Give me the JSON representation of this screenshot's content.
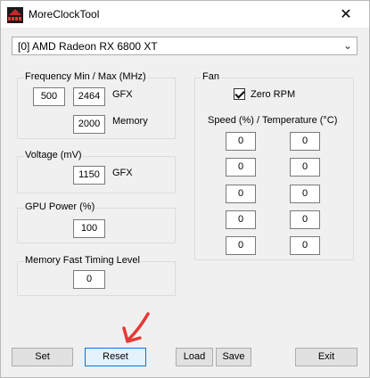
{
  "window": {
    "title": "MoreClockTool",
    "close_glyph": "✕",
    "icon": "app-logo-icon"
  },
  "gpu_select": {
    "value": "[0] AMD Radeon RX 6800 XT",
    "arrow": "⌄"
  },
  "frequency": {
    "title": "Frequency Min / Max (MHz)",
    "min": "500",
    "max": "2464",
    "gfx_label": "GFX",
    "memory": "2000",
    "memory_label": "Memory"
  },
  "voltage": {
    "title": "Voltage (mV)",
    "value": "1150",
    "gfx_label": "GFX"
  },
  "power": {
    "title": "GPU Power (%)",
    "value": "100"
  },
  "mem_timing": {
    "title": "Memory Fast Timing Level",
    "value": "0"
  },
  "fan": {
    "title": "Fan",
    "zero_rpm_label": "Zero RPM",
    "zero_rpm_checked": true,
    "curve_header": "Speed (%) / Temperature (°C)",
    "rows": [
      {
        "speed": "0",
        "temp": "0"
      },
      {
        "speed": "0",
        "temp": "0"
      },
      {
        "speed": "0",
        "temp": "0"
      },
      {
        "speed": "0",
        "temp": "0"
      },
      {
        "speed": "0",
        "temp": "0"
      }
    ]
  },
  "buttons": {
    "set": "Set",
    "reset": "Reset",
    "load": "Load",
    "save": "Save",
    "exit": "Exit"
  },
  "annotation": {
    "color": "#e53935"
  }
}
